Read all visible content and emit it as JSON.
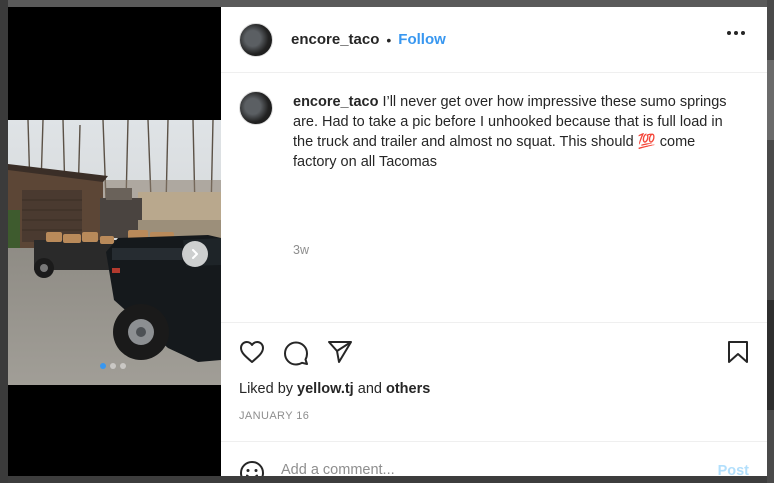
{
  "post": {
    "username": "encore_taco",
    "separator": "•",
    "follow_label": "Follow",
    "caption": {
      "username": "encore_taco",
      "text": "I’ll never get over how impressive these sumo springs are. Had to take a pic before I unhooked because that is full load in the truck and trailer and almost no squat. This should 💯 come factory on all Tacomas",
      "time": "3w"
    },
    "liked_by_prefix": "Liked by",
    "liked_by_user": "yellow.tj",
    "liked_by_and": "and",
    "liked_by_others": "others",
    "date": "JANUARY 16",
    "comment_placeholder": "Add a comment...",
    "post_label": "Post"
  },
  "media": {
    "current_slide": 1,
    "total_slides": 3
  },
  "icons": {
    "more": "more-options-icon",
    "like": "heart-icon",
    "comment": "comment-icon",
    "share": "paper-plane-icon",
    "save": "bookmark-icon",
    "emoji": "smiley-icon",
    "next": "chevron-right-icon"
  },
  "colors": {
    "accent": "#3897f0",
    "post_disabled": "#b2dffc",
    "text": "#262626",
    "muted": "#8e8e8e"
  }
}
